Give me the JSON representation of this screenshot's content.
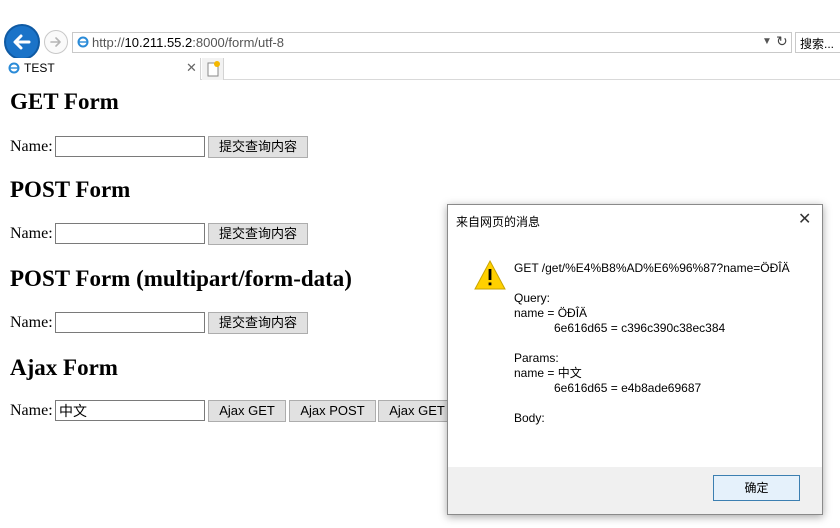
{
  "browser": {
    "url_prefix": "http://",
    "url_host": "10.211.55.2",
    "url_rest": ":8000/form/utf-8",
    "search_placeholder": "搜索...",
    "tab_title": "TEST"
  },
  "page": {
    "sections": [
      {
        "heading": "GET Form",
        "label": "Name:",
        "value": "",
        "buttons": [
          "提交查询内容"
        ]
      },
      {
        "heading": "POST Form",
        "label": "Name:",
        "value": "",
        "buttons": [
          "提交查询内容"
        ]
      },
      {
        "heading": "POST Form (multipart/form-data)",
        "label": "Name:",
        "value": "",
        "buttons": [
          "提交查询内容"
        ]
      },
      {
        "heading": "Ajax Form",
        "label": "Name:",
        "value": "中文",
        "buttons": [
          "Ajax GET",
          "Ajax POST",
          "Ajax GET"
        ]
      }
    ]
  },
  "dialog": {
    "title": "来自网页的消息",
    "message": "GET /get/%E4%B8%AD%E6%96%87?name=ÖÐÎÄ\n\nQuery:\nname = ÖÐÎÄ\n            6e616d65 = c396c390c38ec384\n\nParams:\nname = 中文\n            6e616d65 = e4b8ade69687\n\nBody:",
    "ok_label": "确定"
  },
  "colors": {
    "back_button": "#1a73c8",
    "warning_yellow": "#ffd000"
  }
}
